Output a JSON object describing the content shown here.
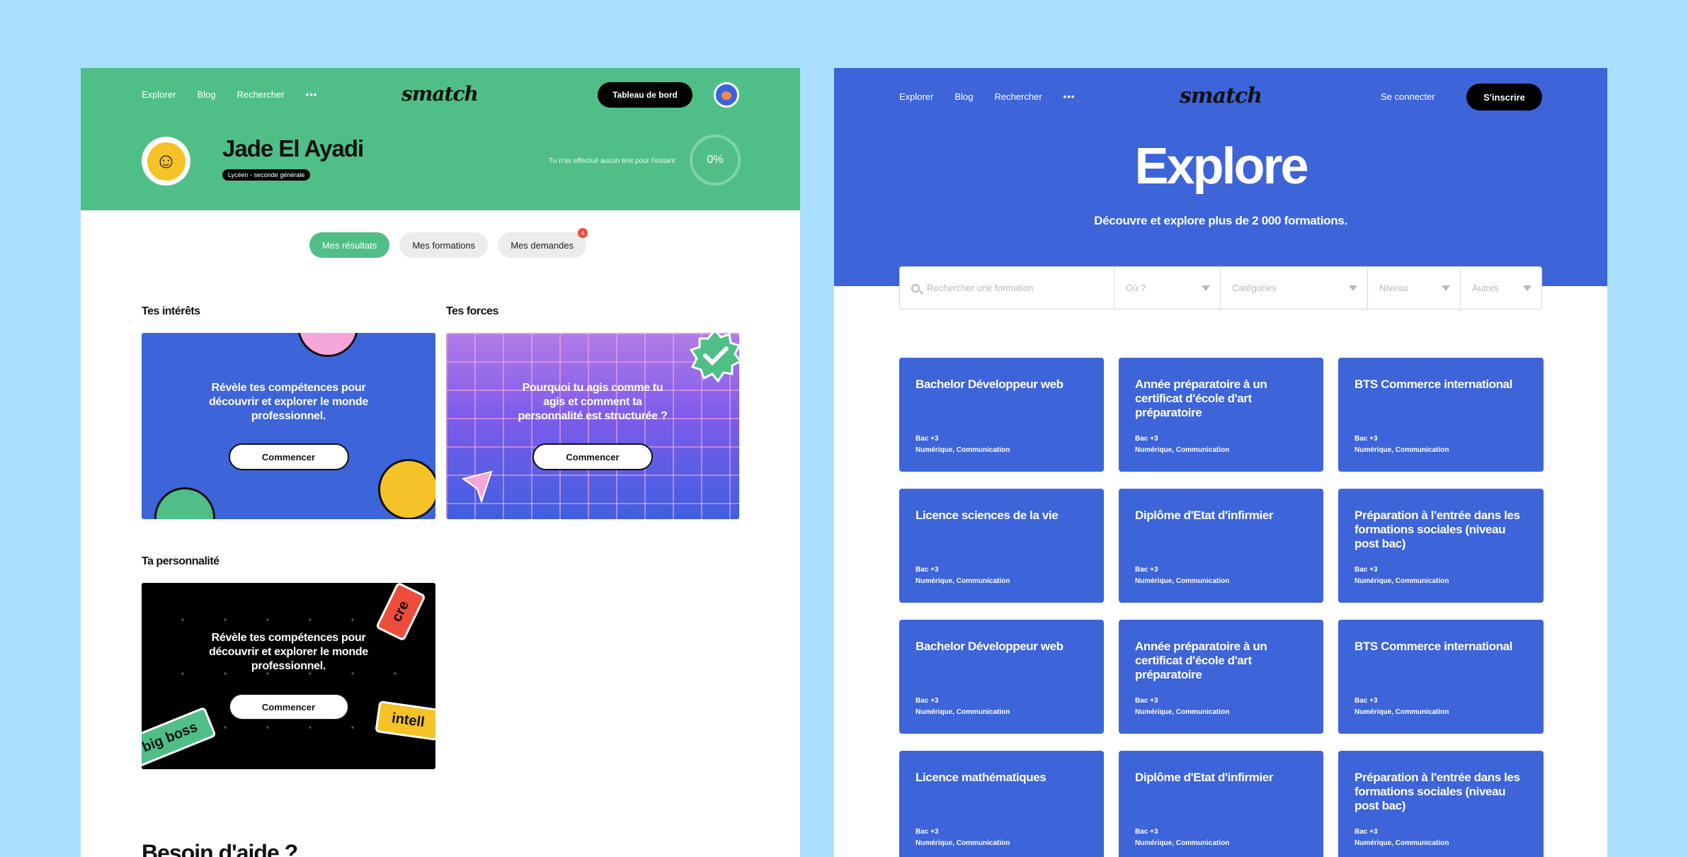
{
  "left": {
    "nav": [
      "Explorer",
      "Blog",
      "Rechercher"
    ],
    "more": "•••",
    "logo": "smatch",
    "dashboard_button": "Tableau de bord",
    "user_name": "Jade El Ayadi",
    "user_badge": "Lycéen - seconde générale",
    "no_test_text": "Tu n'as effectué aucun test pour l'instant",
    "progress": "0%",
    "tabs": [
      {
        "label": "Mes résultats"
      },
      {
        "label": "Mes formations"
      },
      {
        "label": "Mes demandes",
        "badge": "4"
      }
    ],
    "sections": {
      "interets": {
        "title": "Tes intérêts",
        "text": "Révèle tes compétences pour découvrir et explorer le monde professionnel.",
        "button": "Commencer"
      },
      "forces": {
        "title": "Tes forces",
        "text": "Pourquoi tu agis comme tu agis et comment ta personnalité est structurée ?",
        "button": "Commencer"
      },
      "personnalite": {
        "title": "Ta personnalité",
        "text": "Révèle tes compétences pour découvrir et explorer le monde professionnel.",
        "button": "Commencer"
      }
    },
    "stickers": [
      "cre",
      "big boss",
      "intell"
    ],
    "help_title": "Besoin d'aide ?"
  },
  "right": {
    "nav": [
      "Explorer",
      "Blog",
      "Rechercher"
    ],
    "more": "•••",
    "logo": "smatch",
    "login": "Se connecter",
    "signup": "S'inscrire",
    "title": "Explore",
    "subtitle": "Découvre et explore plus de 2 000 formations.",
    "search": {
      "placeholder": "Rechercher une formation",
      "where": "Où ?",
      "categories": "Catégories",
      "level": "Niveau",
      "others": "Autres"
    },
    "formations": [
      {
        "title": "Bachelor Développeur web",
        "level": "Bac +3",
        "tags": "Numérique, Communication"
      },
      {
        "title": "Année préparatoire à un certificat d'école d'art préparatoire",
        "level": "Bac +3",
        "tags": "Numérique, Communication"
      },
      {
        "title": "BTS Commerce international",
        "level": "Bac +3",
        "tags": "Numérique, Communication"
      },
      {
        "title": "Licence sciences de la vie",
        "level": "Bac +3",
        "tags": "Numérique, Communication"
      },
      {
        "title": "Diplôme d'Etat d'infirmier",
        "level": "Bac +3",
        "tags": "Numérique, Communication"
      },
      {
        "title": "Préparation à l'entrée dans les formations sociales (niveau post bac)",
        "level": "Bac +3",
        "tags": "Numérique, Communication"
      },
      {
        "title": "Bachelor Développeur web",
        "level": "Bac +3",
        "tags": "Numérique, Communication"
      },
      {
        "title": "Année préparatoire à un certificat d'école d'art préparatoire",
        "level": "Bac +3",
        "tags": "Numérique, Communication"
      },
      {
        "title": "BTS Commerce international",
        "level": "Bac +3",
        "tags": "Numérique, Communication"
      },
      {
        "title": "Licence mathématiques",
        "level": "Bac +3",
        "tags": "Numérique, Communication"
      },
      {
        "title": "Diplôme d'Etat d'infirmier",
        "level": "Bac +3",
        "tags": "Numérique, Communication"
      },
      {
        "title": "Préparation à l'entrée dans les formations sociales (niveau post bac)",
        "level": "Bac +3",
        "tags": "Numérique, Communication"
      }
    ]
  }
}
